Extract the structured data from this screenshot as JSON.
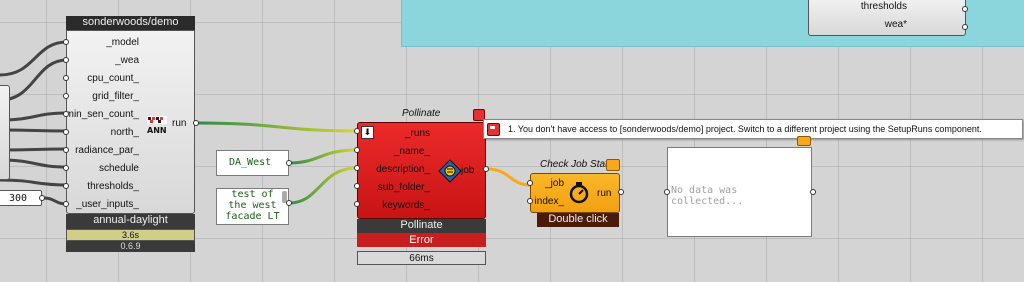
{
  "colors": {
    "canvas": "#d4d4d4",
    "group": "#8ad6dc",
    "error_red": "#e01a1a",
    "job_orange": "#f7a91a",
    "wire_green": "#3a8a3a",
    "wire_yellow": "#cfcf30",
    "wire_orange": "#f28a2a",
    "panel_text": "#1a5c1a"
  },
  "top_component": {
    "outputs": [
      "thresholds",
      "wea*"
    ]
  },
  "left_fragment": {
    "value": "300"
  },
  "annual_daylight": {
    "title": "sonderwoods/demo",
    "inputs": [
      "_model",
      "_wea",
      "cpu_count_",
      "grid_filter_",
      "min_sen_count_",
      "north_",
      "radiance_par_",
      "schedule",
      "thresholds_",
      "_user_inputs_"
    ],
    "output": "run",
    "icon": "ann-icon",
    "name": "annual-daylight",
    "time": "3.6s",
    "version": "0.6.9"
  },
  "panel_name": {
    "text": "DA_West"
  },
  "panel_description": {
    "lines": [
      "test of",
      "the west",
      "facade LT"
    ]
  },
  "pollinate": {
    "title": "Pollinate",
    "inputs": [
      "_runs",
      "_name_",
      "description_",
      "sub_folder_",
      "keywords_"
    ],
    "output": "job",
    "icon": "pollinate-bee-icon",
    "name": "Pollinate",
    "status": "Error",
    "time": "66ms"
  },
  "error_tooltip": {
    "message": "1. You don't have access to [sonderwoods/demo] project. Switch to a different project using the SetupRuns component."
  },
  "check_job_status": {
    "title": "Check Job Status",
    "inputs": [
      "_job",
      "index_"
    ],
    "output": "run",
    "icon": "timer-icon",
    "footer": "Double click"
  },
  "output_panel": {
    "text": "No data was collected..."
  }
}
